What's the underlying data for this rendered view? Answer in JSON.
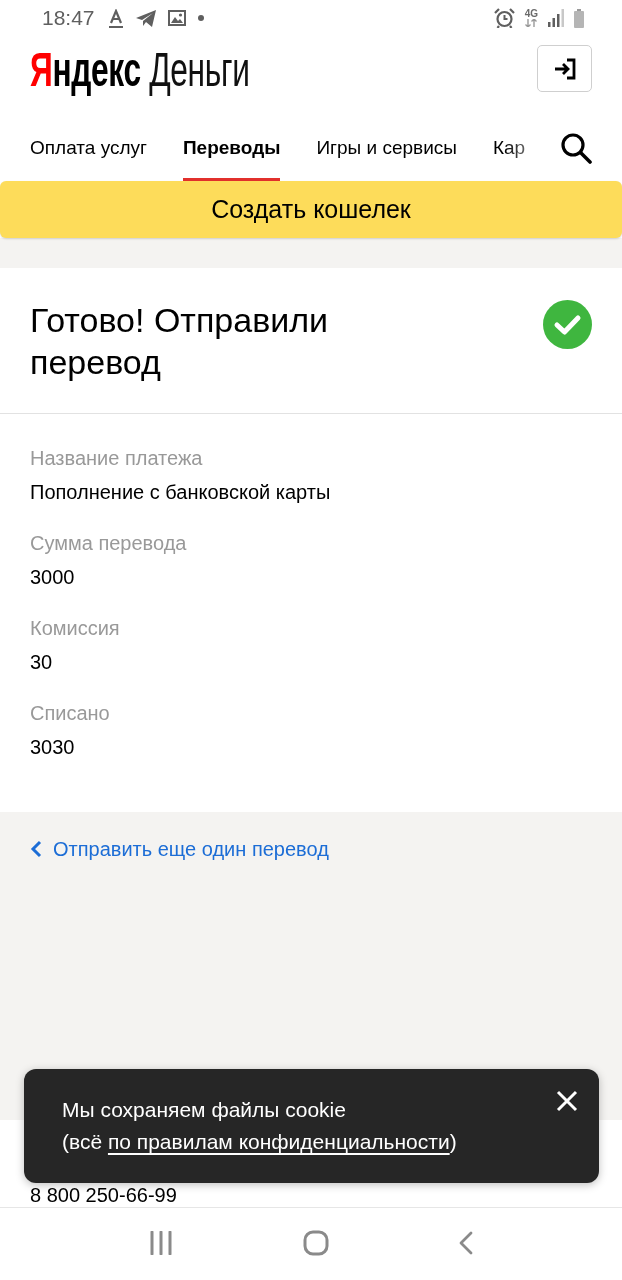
{
  "status_bar": {
    "time": "18:47",
    "network": "4G"
  },
  "header": {
    "logo": {
      "initial": "Я",
      "brand_rest": "ндекс",
      "product": "Деньги"
    }
  },
  "nav": {
    "tabs": [
      {
        "label": "Оплата услуг",
        "selected": false
      },
      {
        "label": "Переводы",
        "selected": true
      },
      {
        "label": "Игры и сервисы",
        "selected": false
      },
      {
        "label": "Кар",
        "selected": false
      }
    ]
  },
  "create_wallet_button": {
    "label": "Создать кошелек"
  },
  "result": {
    "title": "Готово! Отправили перевод",
    "details": [
      {
        "label": "Название платежа",
        "value": "Пополнение с банковской карты"
      },
      {
        "label": "Сумма перевода",
        "value": "3000"
      },
      {
        "label": "Комиссия",
        "value": "30"
      },
      {
        "label": "Списано",
        "value": "3030"
      }
    ]
  },
  "back_link": {
    "label": "Отправить еще один перевод"
  },
  "footer": {
    "phone": "8 800 250-66-99"
  },
  "cookie_notice": {
    "message": "Мы сохраняем файлы cookie",
    "note_prefix": "(всё",
    "link": "по правилам конфиденциальности",
    "note_suffix": ")"
  }
}
